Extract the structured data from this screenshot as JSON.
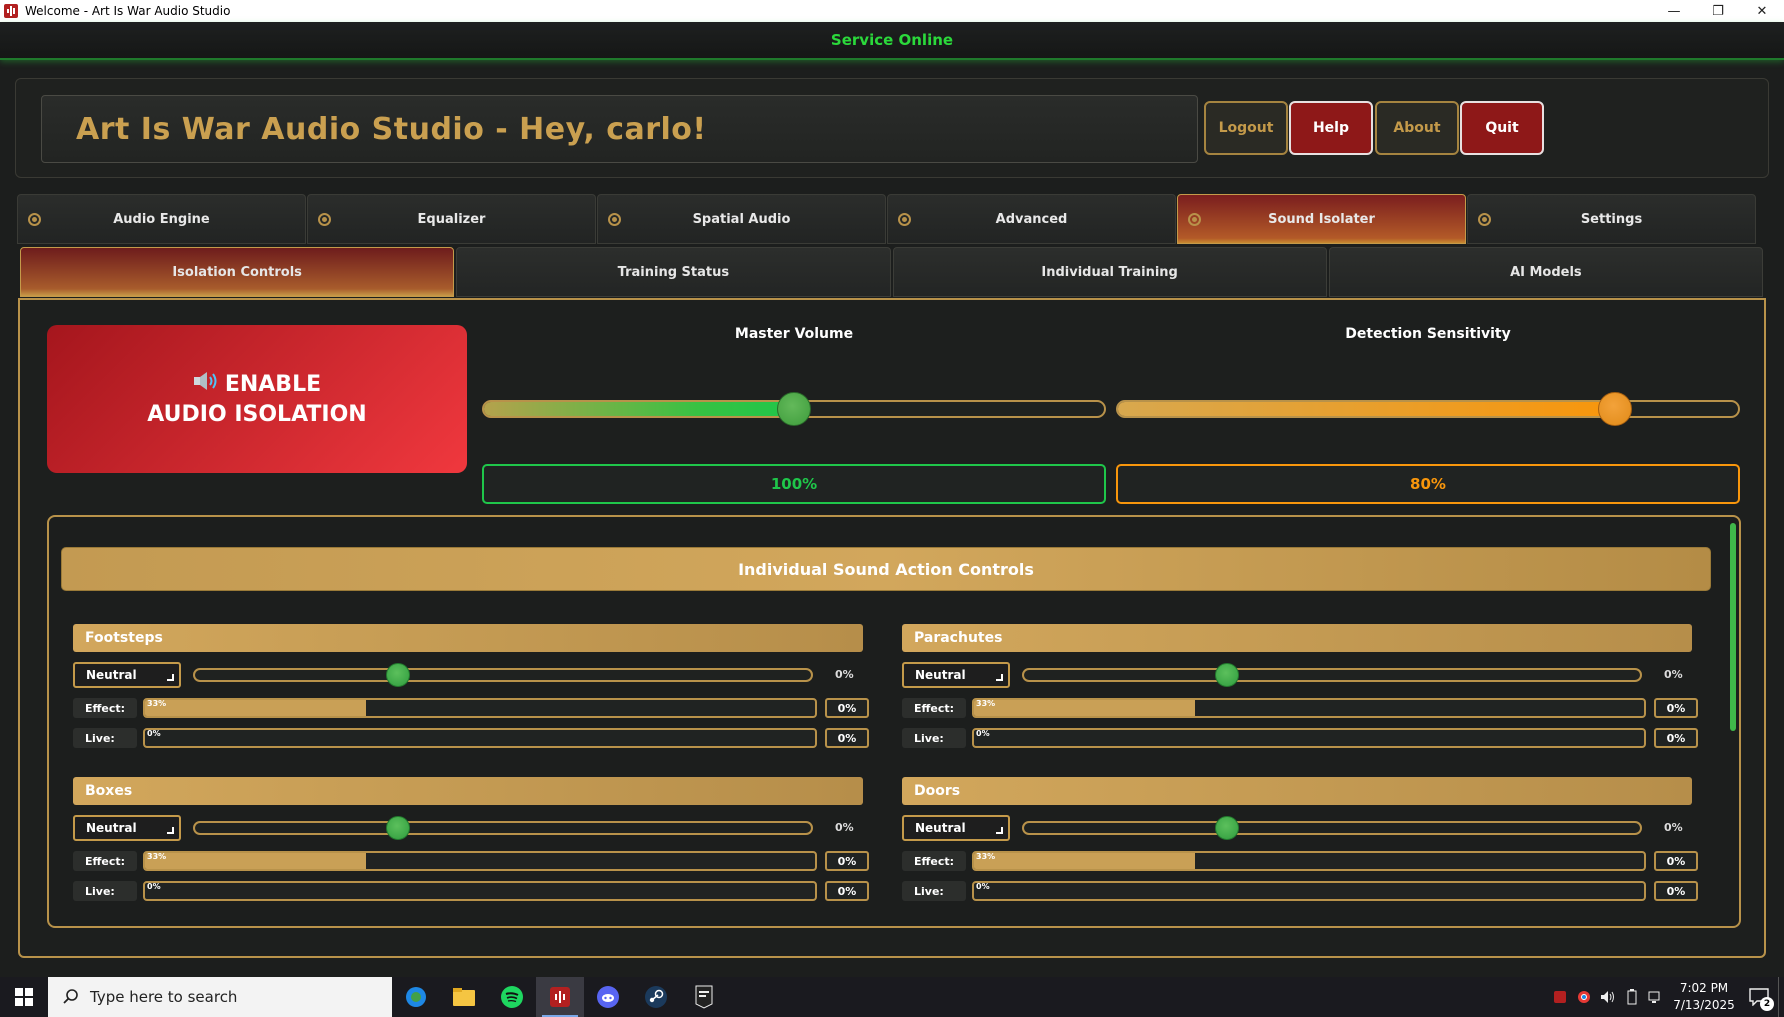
{
  "window": {
    "title": "Welcome - Art Is War Audio Studio",
    "minimize": "—",
    "maximize": "❐",
    "close": "✕"
  },
  "status": {
    "text": "Service Online",
    "color": "#2bd93b"
  },
  "header": {
    "title": "Art Is War Audio Studio - Hey, carlo!",
    "buttons": {
      "logout": "Logout",
      "help": "Help",
      "about": "About",
      "quit": "Quit"
    }
  },
  "main_tabs": [
    "Audio Engine",
    "Equalizer",
    "Spatial Audio",
    "Advanced",
    "Sound Isolater",
    "Settings"
  ],
  "main_tab_active": "Sound Isolater",
  "sub_tabs": [
    "Isolation Controls",
    "Training Status",
    "Individual Training",
    "AI Models"
  ],
  "sub_tab_active": "Isolation Controls",
  "enable_button": {
    "line1": "ENABLE",
    "line2": "AUDIO ISOLATION"
  },
  "master_volume": {
    "label": "Master Volume",
    "value_text": "100%",
    "level": 0.5,
    "color": "#1fc64a"
  },
  "detection_sensitivity": {
    "label": "Detection Sensitivity",
    "value_text": "80%",
    "level": 0.8,
    "color": "#f8960c"
  },
  "sound_panel": {
    "title": "Individual Sound Action Controls"
  },
  "sounds": [
    {
      "name": "Footsteps",
      "mode": "Neutral",
      "slider_level": 0.33,
      "slider_pct": "0%",
      "effect_label": "Effect:",
      "effect_level": 0.33,
      "effect_text": "33%",
      "effect_pct": "0%",
      "live_label": "Live:",
      "live_level": 0,
      "live_text": "0%",
      "live_pct": "0%"
    },
    {
      "name": "Parachutes",
      "mode": "Neutral",
      "slider_level": 0.33,
      "slider_pct": "0%",
      "effect_label": "Effect:",
      "effect_level": 0.33,
      "effect_text": "33%",
      "effect_pct": "0%",
      "live_label": "Live:",
      "live_level": 0,
      "live_text": "0%",
      "live_pct": "0%"
    },
    {
      "name": "Boxes",
      "mode": "Neutral",
      "slider_level": 0.33,
      "slider_pct": "0%",
      "effect_label": "Effect:",
      "effect_level": 0.33,
      "effect_text": "33%",
      "effect_pct": "0%",
      "live_label": "Live:",
      "live_level": 0,
      "live_text": "0%",
      "live_pct": "0%"
    },
    {
      "name": "Doors",
      "mode": "Neutral",
      "slider_level": 0.33,
      "slider_pct": "0%",
      "effect_label": "Effect:",
      "effect_level": 0.33,
      "effect_text": "33%",
      "effect_pct": "0%",
      "live_label": "Live:",
      "live_level": 0,
      "live_text": "0%",
      "live_pct": "0%"
    }
  ],
  "taskbar": {
    "search_placeholder": "Type here to search",
    "time": "7:02 PM",
    "date": "7/13/2025",
    "notifications": "2"
  }
}
